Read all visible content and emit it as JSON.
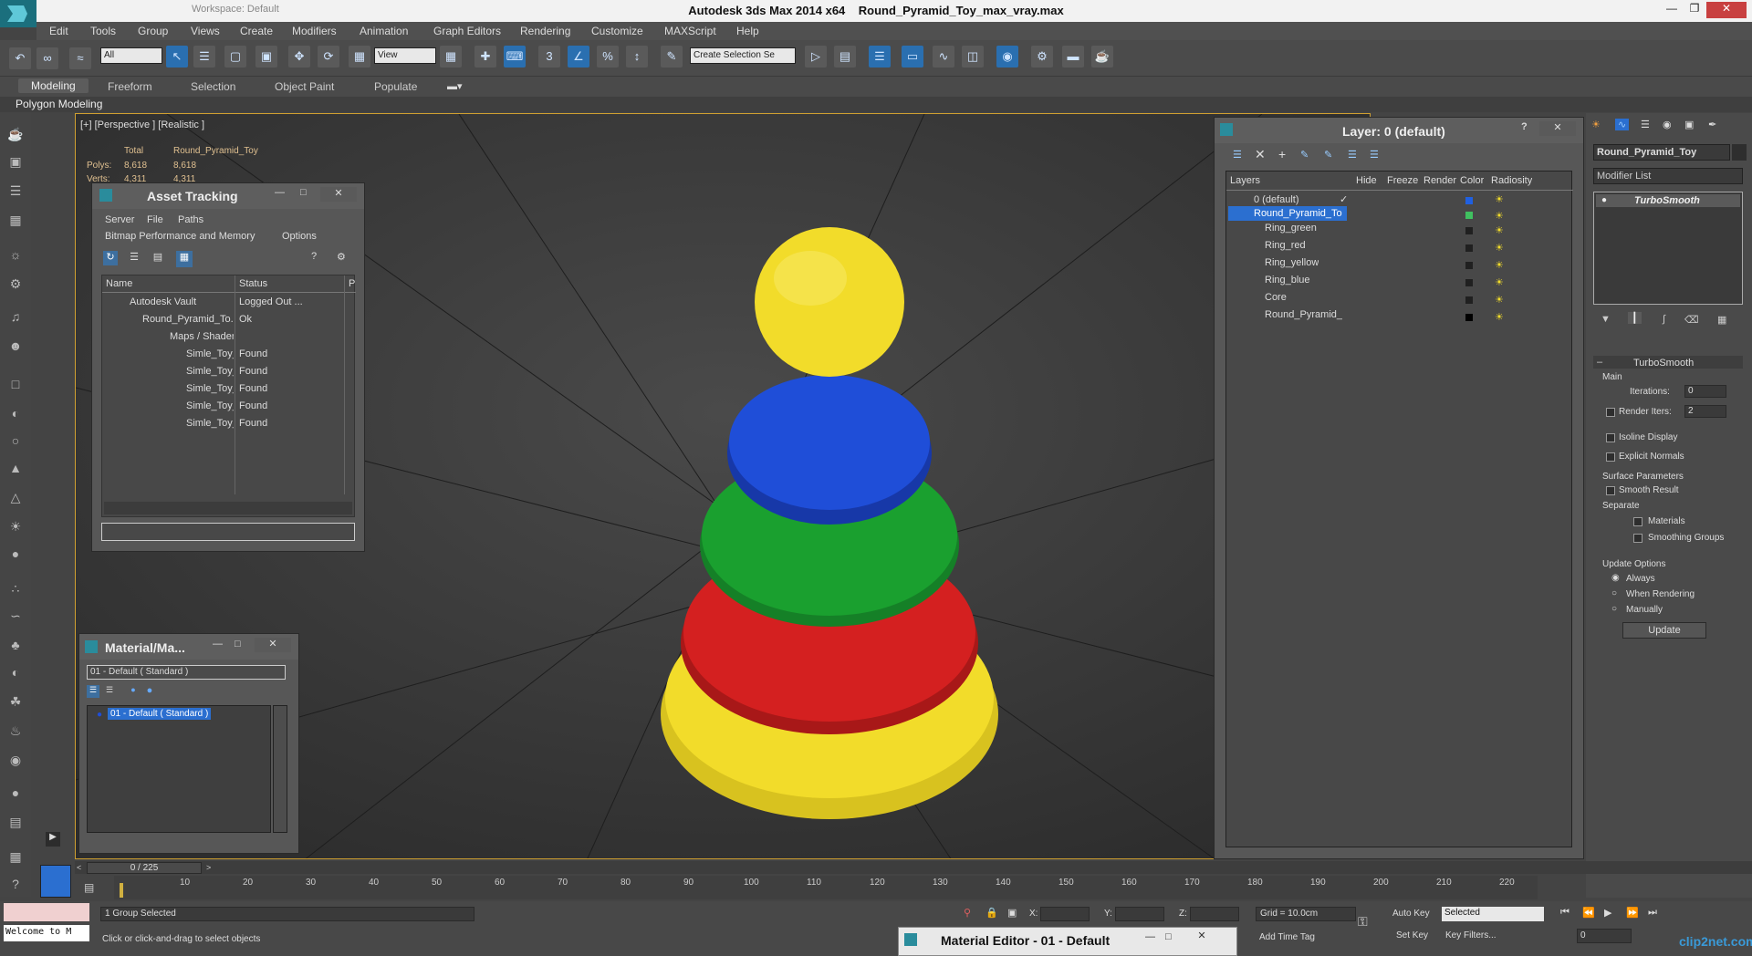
{
  "window": {
    "app": "Autodesk 3ds Max  2014 x64",
    "file": "Round_Pyramid_Toy_max_vray.max",
    "workspace": "Workspace: Default"
  },
  "menu": [
    "Edit",
    "Tools",
    "Group",
    "Views",
    "Create",
    "Modifiers",
    "Animation",
    "Graph Editors",
    "Rendering",
    "Customize",
    "MAXScript",
    "Help"
  ],
  "toolbar": {
    "filter_select": "All",
    "view_select": "View",
    "selection_set": "Create Selection Se"
  },
  "ribbon": {
    "tabs": [
      "Modeling",
      "Freeform",
      "Selection",
      "Object Paint",
      "Populate"
    ],
    "sub": "Polygon Modeling"
  },
  "viewport": {
    "label": "[+] [Perspective ] [Realistic ]",
    "stats_total": "Total",
    "stats_object": "Round_Pyramid_Toy",
    "polys_label": "Polys:",
    "polys_total": "8,618",
    "polys_obj": "8,618",
    "verts_label": "Verts:",
    "verts_total": "4,311",
    "verts_obj": "4,311",
    "colors": {
      "yellow": "#f2dc2a",
      "blue": "#1f4ed8",
      "green": "#1aa02f",
      "red": "#d42020"
    }
  },
  "asset_tracking": {
    "title": "Asset Tracking",
    "menu1": [
      "Server",
      "File",
      "Paths"
    ],
    "menu2": [
      "Bitmap Performance and Memory",
      "Options"
    ],
    "cols": [
      "Name",
      "Status",
      "P"
    ],
    "rows": [
      {
        "name": "Autodesk Vault",
        "status": "Logged Out ..."
      },
      {
        "name": "Round_Pyramid_To...",
        "status": "Ok"
      },
      {
        "name": "Maps / Shaders",
        "status": ""
      },
      {
        "name": "Simle_Toy_Dif...",
        "status": "Found"
      },
      {
        "name": "Simle_Toy_Fre...",
        "status": "Found"
      },
      {
        "name": "Simle_Toy_Gl...",
        "status": "Found"
      },
      {
        "name": "Simle_Toy_NR...",
        "status": "Found"
      },
      {
        "name": "Simle_Toy_Sp...",
        "status": "Found"
      }
    ]
  },
  "material_map": {
    "title": "Material/Ma...",
    "field": "01 - Default  ( Standard )",
    "item": "01 - Default  ( Standard )"
  },
  "layer_dialog": {
    "title": "Layer: 0 (default)",
    "cols": [
      "Layers",
      "Hide",
      "Freeze",
      "Render",
      "Color",
      "Radiosity"
    ],
    "rows": [
      {
        "name": "0 (default)",
        "color": "#2060e0"
      },
      {
        "name": "Round_Pyramid_To",
        "color": "#40c060"
      },
      {
        "name": "Ring_green",
        "color": "#202020"
      },
      {
        "name": "Ring_red",
        "color": "#202020"
      },
      {
        "name": "Ring_yellow",
        "color": "#202020"
      },
      {
        "name": "Ring_blue",
        "color": "#202020"
      },
      {
        "name": "Core",
        "color": "#202020"
      },
      {
        "name": "Round_Pyramid_",
        "color": "#000000"
      }
    ]
  },
  "command_panel": {
    "object_name": "Round_Pyramid_Toy",
    "modifier_list": "Modifier List",
    "stack_item": "TurboSmooth",
    "rollout": "TurboSmooth",
    "main": "Main",
    "iterations_label": "Iterations:",
    "iterations": "0",
    "render_iters_label": "Render Iters:",
    "render_iters": "2",
    "isoline": "Isoline Display",
    "explicit": "Explicit Normals",
    "surface": "Surface Parameters",
    "smooth_result": "Smooth Result",
    "separate": "Separate",
    "materials": "Materials",
    "smoothing_groups": "Smoothing Groups",
    "update_options": "Update Options",
    "always": "Always",
    "when_rendering": "When Rendering",
    "manually": "Manually",
    "update_btn": "Update"
  },
  "timeline": {
    "frame": "0 / 225",
    "ticks": [
      "10",
      "20",
      "30",
      "40",
      "50",
      "60",
      "70",
      "80",
      "90",
      "100",
      "110",
      "120",
      "130",
      "140",
      "150",
      "160",
      "170",
      "180",
      "190",
      "200",
      "210",
      "220"
    ]
  },
  "status": {
    "script": "Welcome to M",
    "selected": "1 Group Selected",
    "prompt": "Click or click-and-drag to select objects",
    "x_label": "X:",
    "y_label": "Y:",
    "z_label": "Z:",
    "grid": "Grid = 10.0cm",
    "add_time_tag": "Add Time Tag",
    "auto_key": "Auto Key",
    "set_key": "Set Key",
    "selected_dd": "Selected",
    "key_filters": "Key Filters...",
    "frame_field": "0",
    "mat_editor_title": "Material Editor - 01 - Default",
    "watermark": "clip2net.com"
  }
}
